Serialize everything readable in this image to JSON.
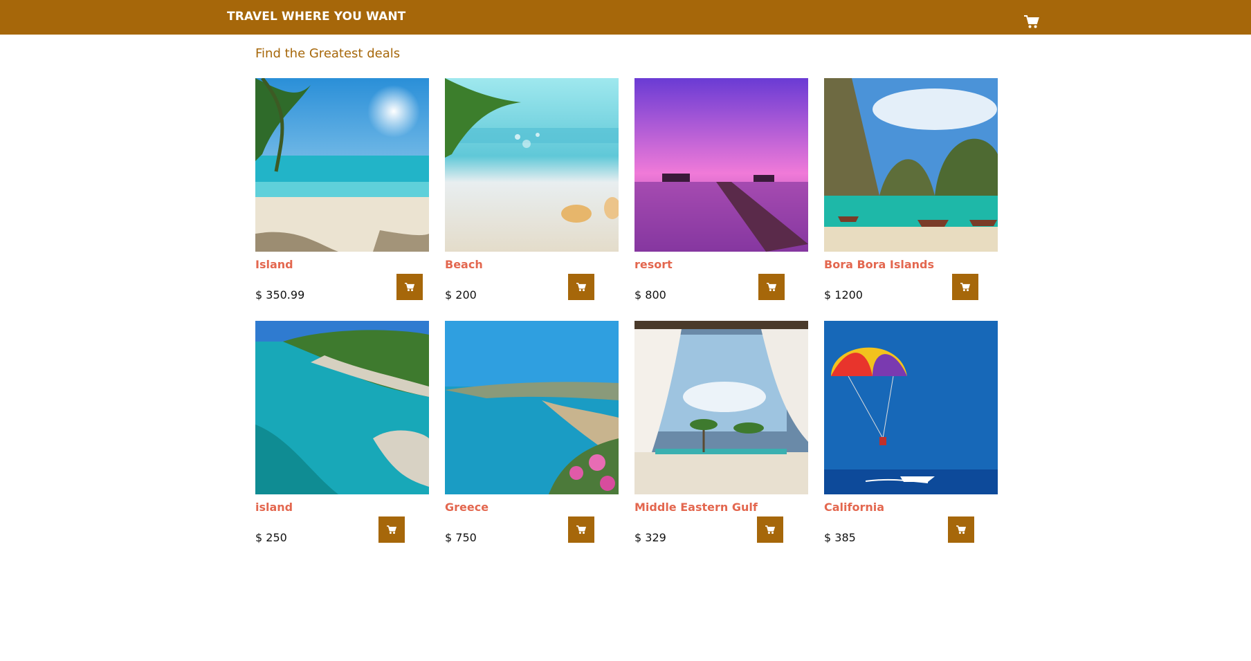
{
  "header": {
    "brand": "TRAVEL WHERE YOU WANT",
    "cart_icon": "shopping-cart-icon"
  },
  "main": {
    "subtitle": "Find the Greatest deals"
  },
  "colors": {
    "header_bg": "#a6670a",
    "subtitle": "#a6670a",
    "product_name": "#e3674f",
    "button_bg": "#a6670a"
  },
  "products": [
    {
      "name": "Island",
      "price": "$ 350.99",
      "image": "tropical beach with palm tree and sun"
    },
    {
      "name": "Beach",
      "price": "$ 200",
      "image": "sandy beach with palm leaves and seashells"
    },
    {
      "name": "resort",
      "price": "$ 800",
      "image": "pink sunset over water villas and pier"
    },
    {
      "name": "Bora Bora Islands",
      "price": "$ 1200",
      "image": "limestone cliffs with longtail boats"
    },
    {
      "name": "island",
      "price": "$ 250",
      "image": "turquoise cove with rocky green coast"
    },
    {
      "name": "Greece",
      "price": "$ 750",
      "image": "coastal town with pink flowers and sea"
    },
    {
      "name": "Middle Eastern Gulf",
      "price": "$ 329",
      "image": "white curtains framing a palm beach"
    },
    {
      "name": "California",
      "price": "$ 385",
      "image": "parasailing over blue sea with boat"
    }
  ]
}
